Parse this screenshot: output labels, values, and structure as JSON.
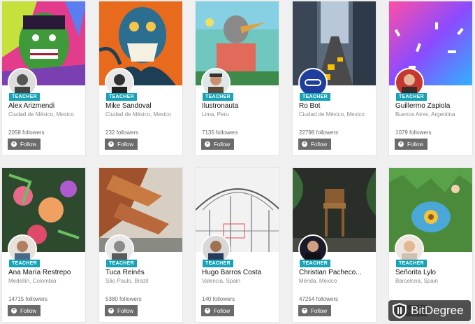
{
  "button_label": "Follow",
  "badge_label": "TEACHER",
  "teachers": [
    {
      "name": "Alex Arizmendi",
      "location": "Ciudad de México, Mexico",
      "followers": "2058 followers"
    },
    {
      "name": "Mike Sandoval",
      "location": "Ciudad de México, Mexico",
      "followers": "232 followers"
    },
    {
      "name": "Ilustronauta",
      "location": "Lima, Peru",
      "followers": "7135 followers"
    },
    {
      "name": "Ro Bot",
      "location": "Ciudad de México, Mexico",
      "followers": "22798 followers"
    },
    {
      "name": "Guillermo Zapiola",
      "location": "Buenos Aires, Argentina",
      "followers": "1079 followers"
    },
    {
      "name": "Ana María Restrepo",
      "location": "Medellín, Colombia",
      "followers": "14715 followers"
    },
    {
      "name": "Tuca Reinés",
      "location": "São Paulo, Brazil",
      "followers": "5380 followers"
    },
    {
      "name": "Hugo Barros Costa",
      "location": "Valencia, Spain",
      "followers": "140 followers"
    },
    {
      "name": "Christian Pacheco...",
      "location": "Mérida, Mexico",
      "followers": "47254 followers"
    },
    {
      "name": "Señorita Lylo",
      "location": "Barcelona, Spain",
      "followers": ""
    }
  ],
  "watermark": {
    "text": "BitDegree"
  }
}
